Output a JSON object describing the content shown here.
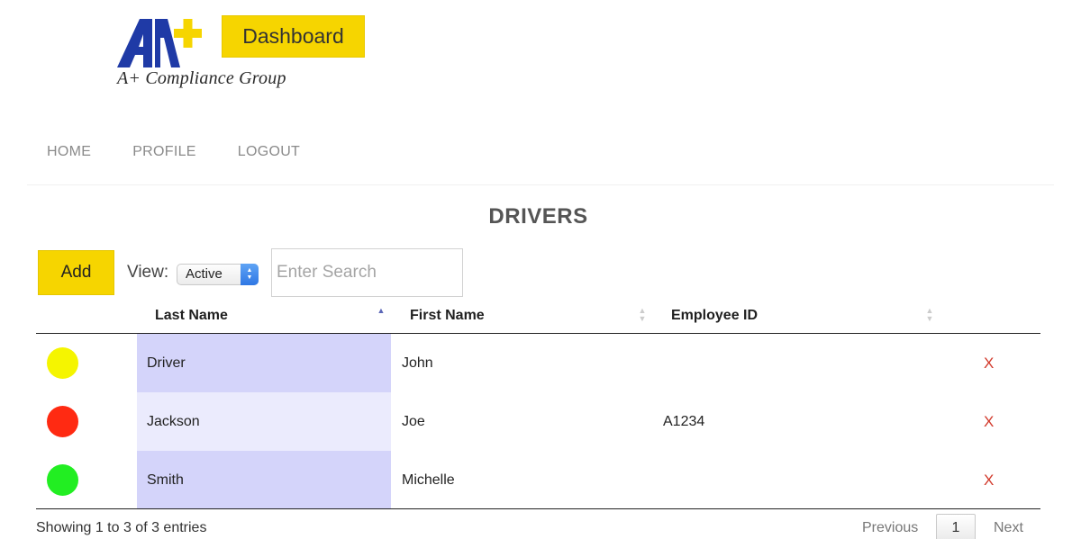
{
  "brand": {
    "logo_text": "A+ Compliance Group",
    "dashboard_label": "Dashboard"
  },
  "nav": {
    "home": "HOME",
    "profile": "PROFILE",
    "logout": "LOGOUT"
  },
  "page_title": "DRIVERS",
  "controls": {
    "add_label": "Add",
    "view_label": "View:",
    "view_selected": "Active",
    "search_placeholder": "Enter Search"
  },
  "table": {
    "columns": [
      "Last Name",
      "First Name",
      "Employee ID"
    ],
    "sorted_column": "Last Name",
    "sort_direction": "ascending",
    "rows": [
      {
        "status_color": "#f5f500",
        "last_name": "Driver",
        "first_name": "John",
        "employee_id": "",
        "delete": "X"
      },
      {
        "status_color": "#ff2a12",
        "last_name": "Jackson",
        "first_name": "Joe",
        "employee_id": "A1234",
        "delete": "X"
      },
      {
        "status_color": "#22ee22",
        "last_name": "Smith",
        "first_name": "Michelle",
        "employee_id": "",
        "delete": "X"
      }
    ]
  },
  "footer": {
    "info": "Showing 1 to 3 of 3 entries",
    "previous": "Previous",
    "current_page": "1",
    "next": "Next"
  },
  "colors": {
    "accent_yellow": "#f6d500",
    "logo_blue": "#1f3aa6",
    "delete_red": "#d23a2c",
    "sorted_column_dark": "#d4d4fa",
    "sorted_column_light": "#ebebfd"
  }
}
